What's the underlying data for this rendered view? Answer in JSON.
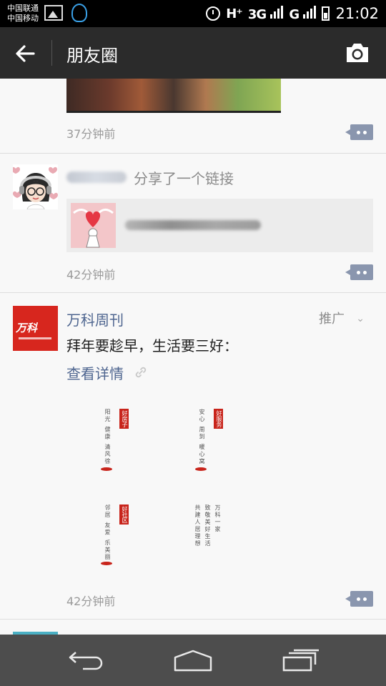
{
  "status_bar": {
    "carrier_1": "中国联通",
    "carrier_2": "中国移动",
    "network_1": "H⁺",
    "network_2": "3G",
    "network_3": "G",
    "time": "21:02"
  },
  "app_bar": {
    "title": "朋友圈",
    "back_icon": "arrow-left-icon",
    "camera_icon": "camera-icon"
  },
  "feed": {
    "posts": [
      {
        "time": "37分钟前",
        "has_image": true
      },
      {
        "share_label": "分享了一个链接",
        "time": "42分钟前"
      },
      {
        "author": "万科周刊",
        "promo_label": "推广",
        "text": "拜年要趁早，生活要三好：",
        "detail_link": "查看详情",
        "time": "42分钟前",
        "poster": {
          "col1_text": "阳光 健康 清风徐",
          "col1_seal": "好房子",
          "col2_text": "安心 周到 暖心窝",
          "col2_seal": "好服务",
          "col3_text": "邻居 友爱 乐美丽",
          "col3_seal": "好社区",
          "col4_text": "万科一家",
          "col5_text": "致敬美好生活",
          "col6_text": "共建人居理想"
        }
      }
    ]
  },
  "logo": {
    "vanke_text": "万科"
  },
  "colors": {
    "link_blue": "#4f6690",
    "app_bar": "#2b2b2b",
    "comment_btn": "#8a96ae",
    "brand_red": "#d7261e"
  }
}
